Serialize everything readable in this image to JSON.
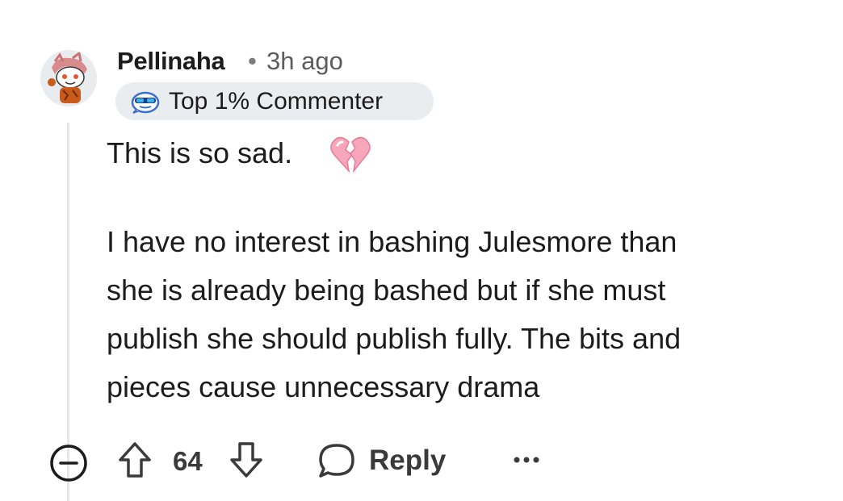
{
  "comment": {
    "username": "Pellinaha",
    "separator": "•",
    "timestamp": "3h ago",
    "flair": {
      "icon": "sunglasses-commenter-icon",
      "label": "Top 1% Commenter"
    },
    "body": {
      "line1": "This is so sad.",
      "emoji": "broken-heart-icon",
      "paragraph": [
        "I have no interest in bashing Julesmore than",
        "she is already being bashed but if she must",
        "publish she should publish fully. The bits and",
        "pieces cause unnecessary drama"
      ]
    }
  },
  "actions": {
    "vote_count": "64",
    "reply_label": "Reply",
    "icons": [
      "collapse-icon",
      "upvote-icon",
      "downvote-icon",
      "comment-bubble-icon",
      "more-options-icon"
    ]
  },
  "colors": {
    "text": "#1c1c1c",
    "muted": "#5c5c5c",
    "flair_bg": "#eaedf0",
    "thread_line": "#e4e6e8",
    "heart": "#f4a3b8"
  }
}
